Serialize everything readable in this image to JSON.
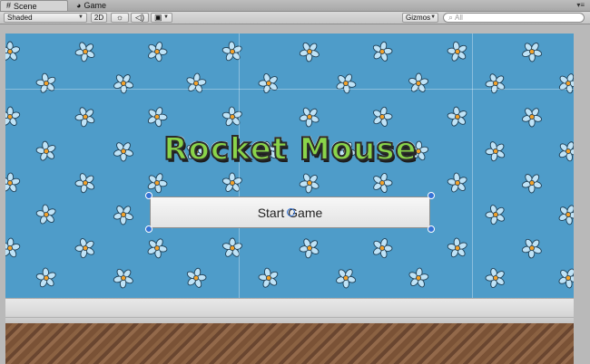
{
  "tabs": [
    {
      "label": "Scene",
      "icon": "grid-icon",
      "active": true
    },
    {
      "label": "Game",
      "icon": "pacman-icon",
      "active": false
    }
  ],
  "toolbar": {
    "shading_mode": "Shaded",
    "mode_2d": "2D",
    "gizmos_label": "Gizmos",
    "search_placeholder": "All"
  },
  "scene": {
    "title_text": "Rocket Mouse",
    "button_label": "Start Game",
    "colors": {
      "sky": "#4e9cc9",
      "title_fill": "#8ad44a",
      "selection_handle": "#3572d6"
    }
  }
}
